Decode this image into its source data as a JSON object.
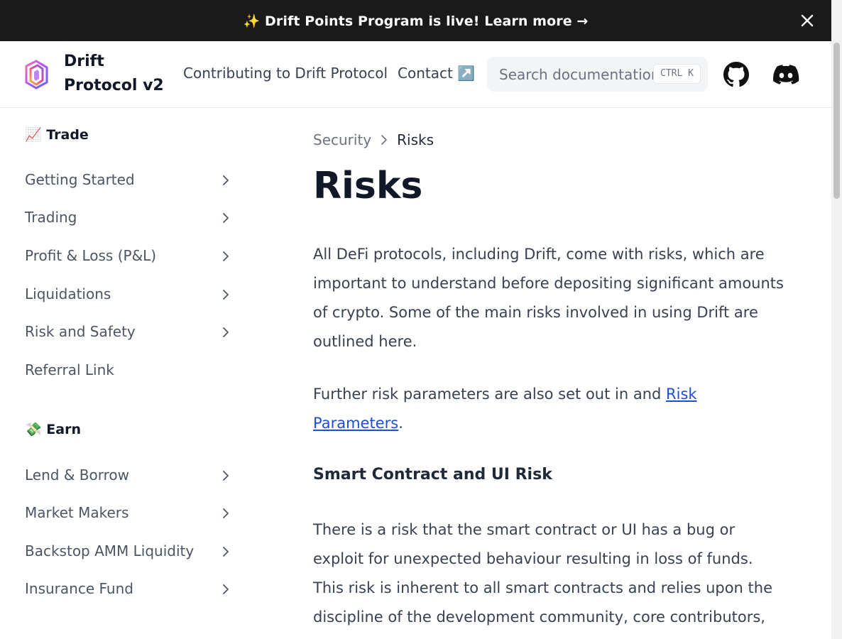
{
  "banner": {
    "emoji": "✨",
    "text": "Drift Points Program is live! Learn more →"
  },
  "header": {
    "logo_title_line1": "Drift",
    "logo_title_line2": "Protocol v2",
    "nav": {
      "contributing": "Contributing to Drift Protocol",
      "contact": "Contact ↗️"
    },
    "search": {
      "placeholder": "Search documentation...",
      "shortcut": "CTRL K"
    },
    "icons": [
      "github-icon",
      "discord-icon"
    ]
  },
  "sidebar": {
    "trade_title": "📈 Trade",
    "trade_items": [
      {
        "label": "Getting Started",
        "expandable": true
      },
      {
        "label": "Trading",
        "expandable": true
      },
      {
        "label": "Profit & Loss (P&L)",
        "expandable": true
      },
      {
        "label": "Liquidations",
        "expandable": true
      },
      {
        "label": "Risk and Safety",
        "expandable": true
      },
      {
        "label": "Referral Link",
        "expandable": false
      }
    ],
    "earn_title": "💸 Earn",
    "earn_items": [
      {
        "label": "Lend & Borrow",
        "expandable": true
      },
      {
        "label": "Market Makers",
        "expandable": true
      },
      {
        "label": "Backstop AMM Liquidity",
        "expandable": true
      },
      {
        "label": "Insurance Fund",
        "expandable": true
      }
    ]
  },
  "main": {
    "breadcrumb": {
      "parent": "Security",
      "current": "Risks"
    },
    "title": "Risks",
    "intro": "All DeFi protocols, including Drift, come with risks, which are important to understand before depositing significant amounts of crypto. Some of the main risks involved in using Drift are outlined here.",
    "further_prefix": "Further risk parameters are also set out in and ",
    "further_link": "Risk Parameters",
    "further_suffix": ".",
    "section1_title": "Smart Contract and UI Risk",
    "section1_body": "There is a risk that the smart contract or UI has a bug or exploit for unexpected behaviour resulting in loss of funds. This risk is inherent to all smart contracts and relies upon the discipline of the development community, core contributors, and auditors."
  },
  "colors": {
    "banner_bg": "#1a1a1a",
    "link": "#1d4ed8",
    "text": "#374151"
  }
}
